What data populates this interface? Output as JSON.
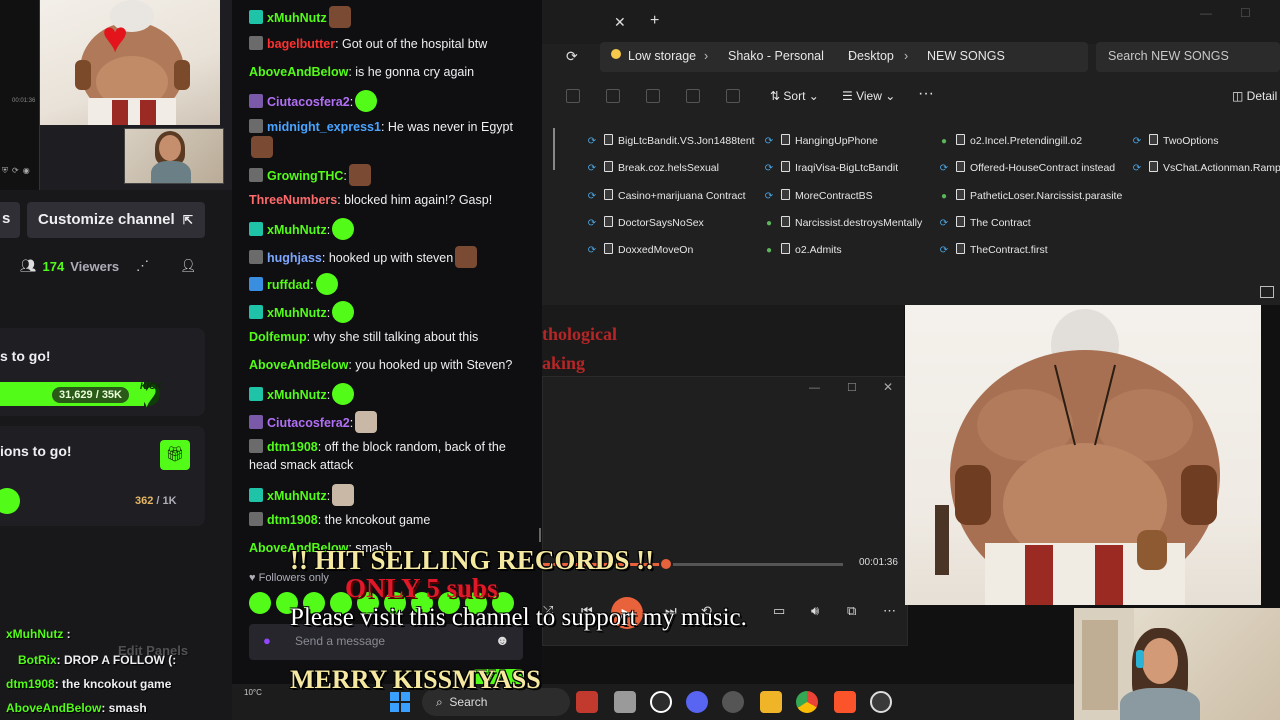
{
  "left_panel": {
    "mini_time": "00:01:36",
    "channel_button_short": "s",
    "customize_button": "Customize channel",
    "viewers_count": "174",
    "viewers_label": "Viewers",
    "goal1": {
      "title": "s to go!",
      "value": "31,629 / 35K",
      "progress": 0.9,
      "badge": "KICK"
    },
    "goal2": {
      "title": "ions to go!",
      "value_current": "362",
      "value_total": " / 1K"
    }
  },
  "mini_chat": [
    {
      "user": "xMuhNutz",
      "text": " :",
      "color": "#53fc18"
    },
    {
      "user": "BotRix",
      "text": ": DROP A FOLLOW (:",
      "color": "#53fc18",
      "overlay": "Edit Panels"
    },
    {
      "user": "dtm1908",
      "text": ": the kncokout game",
      "color": "#53fc18"
    },
    {
      "user": "AboveAndBelow",
      "text": ": smash",
      "color": "#53fc18"
    }
  ],
  "chat": {
    "messages": [
      {
        "user": "xMuhNutz",
        "text": "",
        "color": "#53fc18",
        "badge": "#1fc4a8",
        "emote": "face"
      },
      {
        "user": "bagelbutter",
        "text": ": Got out of the hospital btw",
        "color": "#ff3030",
        "badge": "#6b6b6b"
      },
      {
        "user": "AboveAndBelow",
        "text": ": is he gonna cry again",
        "color": "#53fc18",
        "badge": ""
      },
      {
        "user": "Ciutacosfera2",
        "text": ":",
        "color": "#b06ff5",
        "badge": "#7a5aa8",
        "emote": "green"
      },
      {
        "user": "midnight_express1",
        "text": ": He was never in Egypt",
        "color": "#4aa3ff",
        "badge": "#6b6b6b",
        "emote": "face"
      },
      {
        "user": "GrowingTHC",
        "text": ":",
        "color": "#53fc18",
        "badge": "#6b6b6b",
        "emote": "face"
      },
      {
        "user": "ThreeNumbers",
        "text": ": blocked him again!? Gasp!",
        "color": "#ff6b6b",
        "badge": ""
      },
      {
        "user": "xMuhNutz",
        "text": ":",
        "color": "#53fc18",
        "badge": "#1fc4a8",
        "emote": "green"
      },
      {
        "user": "hughjass",
        "text": ": hooked up with steven",
        "color": "#7da6ff",
        "badge": "#6b6b6b",
        "emote": "face"
      },
      {
        "user": "ruffdad",
        "text": ":",
        "color": "#53fc18",
        "badge": "#3a8ee0",
        "emote": "green"
      },
      {
        "user": "xMuhNutz",
        "text": ":",
        "color": "#53fc18",
        "badge": "#1fc4a8",
        "emote": "green"
      },
      {
        "user": "Dolfemup",
        "text": ": why she still talking about this",
        "color": "#53fc18",
        "badge": ""
      },
      {
        "user": "AboveAndBelow",
        "text": ": you hooked up with Steven?",
        "color": "#53fc18",
        "badge": ""
      },
      {
        "user": "xMuhNutz",
        "text": ":",
        "color": "#53fc18",
        "badge": "#1fc4a8",
        "emote": "green"
      },
      {
        "user": "Ciutacosfera2",
        "text": ":",
        "color": "#b06ff5",
        "badge": "#7a5aa8",
        "emote": "cat"
      },
      {
        "user": "dtm1908",
        "text": ": off the block random, back of the head smack attack",
        "color": "#53fc18",
        "badge": "#6b6b6b"
      },
      {
        "user": "xMuhNutz",
        "text": ":",
        "color": "#53fc18",
        "badge": "#1fc4a8",
        "emote": "cat"
      },
      {
        "user": "dtm1908",
        "text": ": the kncokout game",
        "color": "#53fc18",
        "badge": "#6b6b6b"
      },
      {
        "user": "AboveAndBelow",
        "text": ": smash",
        "color": "#53fc18",
        "badge": ""
      }
    ],
    "followers_only": "Followers only",
    "input_placeholder": "Send a message"
  },
  "explorer": {
    "address": {
      "low_storage": "Low storage",
      "crumb1": "Shako - Personal",
      "crumb2": "Desktop",
      "crumb3": "NEW SONGS"
    },
    "search_placeholder": "Search NEW SONGS",
    "toolbar": {
      "sort": "Sort",
      "view": "View",
      "more": "···",
      "details": "Detail"
    },
    "files": [
      {
        "name": "BigLtcBandit.VS.Jon1488tent",
        "status": "sync"
      },
      {
        "name": "Break.coz.helsSexual",
        "status": "sync"
      },
      {
        "name": "Casino+marijuana Contract",
        "status": "sync"
      },
      {
        "name": "DoctorSaysNoSex",
        "status": "sync"
      },
      {
        "name": "DoxxedMoveOn",
        "status": "sync"
      },
      {
        "name": "HangingUpPhone",
        "status": "sync"
      },
      {
        "name": "IraqiVisa-BigLtcBandit",
        "status": "sync"
      },
      {
        "name": "MoreContractBS",
        "status": "sync"
      },
      {
        "name": "Narcissist.destroysMentally",
        "status": "ok"
      },
      {
        "name": "o2.Admits",
        "status": "ok"
      },
      {
        "name": "o2.Incel.Pretendingill.o2",
        "status": "ok"
      },
      {
        "name": "Offered-HouseContract instead",
        "status": "sync"
      },
      {
        "name": "PatheticLoser.Narcissist.parasite",
        "status": "ok"
      },
      {
        "name": "The Contract",
        "status": "sync"
      },
      {
        "name": "TheContract.first",
        "status": "sync"
      },
      {
        "name": "TwoOptions",
        "status": "sync"
      },
      {
        "name": "VsChat.Actionman.Rampage",
        "status": "sync"
      }
    ]
  },
  "doc_behind": {
    "line1": "thological",
    "line2": "aking"
  },
  "media_player": {
    "time": "00:01:36",
    "progress": 0.41
  },
  "overlay": {
    "hit": "!! HIT SELLING RECORDS !!",
    "only": "ONLY 5 subs",
    "please": "Please visit this channel to support my music.",
    "merry": "MERRY KISSMYASS"
  },
  "taskbar": {
    "search": "Search",
    "weather": "10°C"
  },
  "colors": {
    "kick_green": "#53fc18",
    "chat_bg": "#0f0f11",
    "panel_bg": "#18181b",
    "accent_orange": "#e8623b"
  }
}
